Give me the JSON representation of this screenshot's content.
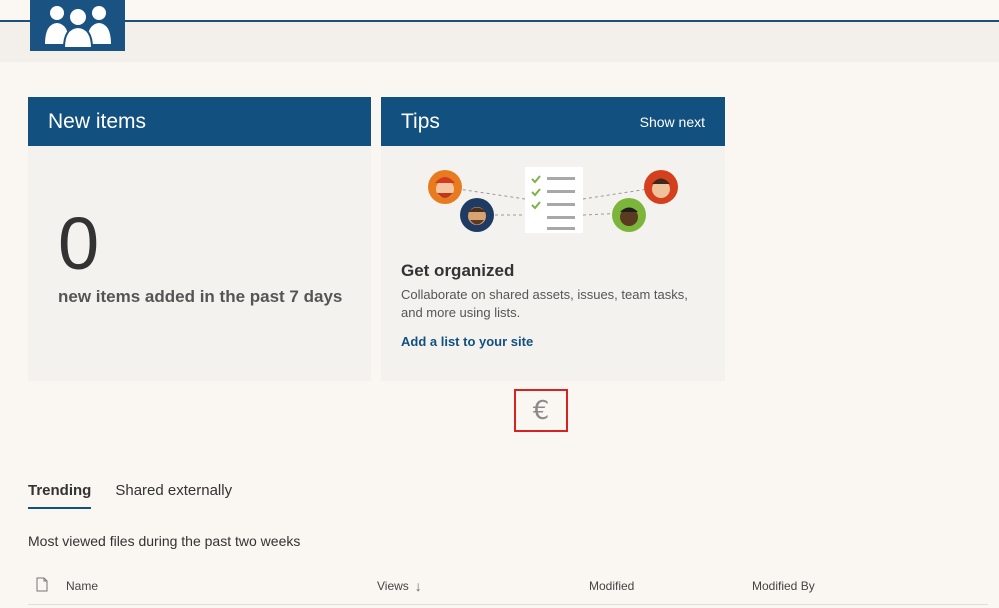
{
  "header": {
    "logo_icon": "people-group-icon",
    "accent": "#12507f"
  },
  "cards": {
    "new_items": {
      "title": "New items",
      "count": "0",
      "caption": "new items added in the past 7 days"
    },
    "tips": {
      "title": "Tips",
      "show_next": "Show next",
      "tip_title": "Get organized",
      "tip_body": "Collaborate on shared assets, issues, team tasks, and more using lists.",
      "tip_link": "Add a list to your site"
    }
  },
  "highlight": {
    "icon": "euro-icon",
    "glyph": "€",
    "border_color": "#d62222"
  },
  "tabs": [
    {
      "label": "Trending",
      "active": true
    },
    {
      "label": "Shared externally",
      "active": false
    }
  ],
  "subtitle": "Most viewed files during the past two weeks",
  "table": {
    "columns": {
      "name": "Name",
      "views": "Views",
      "modified": "Modified",
      "modified_by": "Modified By"
    }
  }
}
